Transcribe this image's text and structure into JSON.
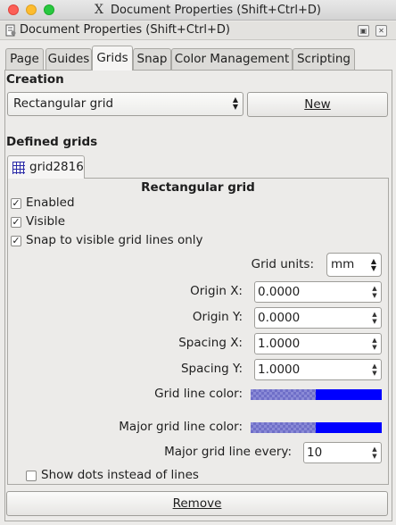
{
  "window": {
    "title": "Document Properties (Shift+Ctrl+D)",
    "x_icon": "X"
  },
  "dock": {
    "title": "Document Properties (Shift+Ctrl+D)",
    "btn_float": "▣",
    "btn_close": "✕"
  },
  "tabs": [
    {
      "label": "Page"
    },
    {
      "label": "Guides"
    },
    {
      "label": "Grids"
    },
    {
      "label": "Snap"
    },
    {
      "label": "Color Management"
    },
    {
      "label": "Scripting"
    }
  ],
  "creation": {
    "title": "Creation",
    "grid_type": "Rectangular grid",
    "new_label": "New"
  },
  "defined": {
    "title": "Defined grids",
    "tab_label": "grid2816",
    "panel_title": "Rectangular grid"
  },
  "checks": {
    "enabled": {
      "label": "Enabled",
      "checked": true
    },
    "visible": {
      "label": "Visible",
      "checked": true
    },
    "snap": {
      "label": "Snap to visible grid lines only",
      "checked": true
    },
    "dots": {
      "label": "Show dots instead of lines",
      "checked": false
    }
  },
  "fields": {
    "grid_units_label": "Grid units:",
    "grid_units_value": "mm",
    "origin_x_label": "Origin X:",
    "origin_x": "0.0000",
    "origin_y_label": "Origin Y:",
    "origin_y": "0.0000",
    "spacing_x_label": "Spacing X:",
    "spacing_x": "1.0000",
    "spacing_y_label": "Spacing Y:",
    "spacing_y": "1.0000",
    "grid_color_label": "Grid line color:",
    "major_color_label": "Major grid line color:",
    "major_every_label": "Major grid line every:",
    "major_every": "10"
  },
  "colors": {
    "grid_line": "#0000ff",
    "major_grid_line": "#0000ff"
  },
  "remove_label": "Remove",
  "check_mark": "✓",
  "arrows": {
    "up": "▲",
    "down": "▼"
  }
}
